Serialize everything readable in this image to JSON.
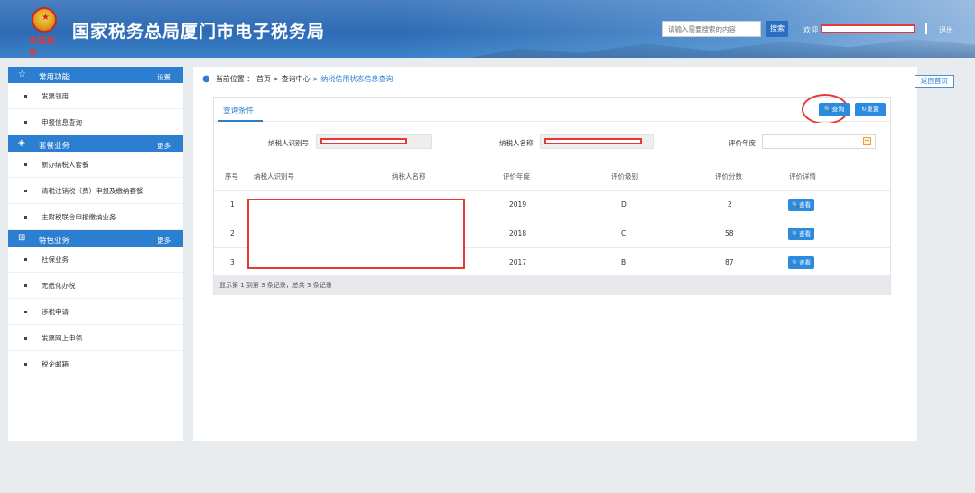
{
  "header": {
    "emblem_seal_text": "中国税务",
    "title": "国家税务总局厦门市电子税务局",
    "search_placeholder": "请输入需要搜索的内容",
    "search_button": "搜索",
    "welcome": "欢迎",
    "logout": "退出"
  },
  "sidebar": {
    "sections": [
      {
        "title": "常用功能",
        "action": "设置",
        "icon": "star-icon",
        "items": [
          "发票领用",
          "申报信息查询"
        ]
      },
      {
        "title": "套餐业务",
        "action": "更多",
        "icon": "layers-icon",
        "items": [
          "新办纳税人套餐",
          "清税注销税（费）申报及缴纳套餐",
          "主附税联合申报缴纳业务"
        ]
      },
      {
        "title": "特色业务",
        "action": "更多",
        "icon": "grid-icon",
        "items": [
          "社保业务",
          "无纸化办税",
          "涉税申请",
          "发票网上申领",
          "税企邮箱"
        ]
      }
    ]
  },
  "breadcrumb": {
    "label": "当前位置 ：",
    "home": "首页",
    "level2": " > 查询中心",
    "current": " > 纳税信用状态信息查询"
  },
  "back_home": "返回首页",
  "query_panel": {
    "tab": "查询条件",
    "query_button": "查询",
    "reset_button": "重置",
    "taxpayer_id_label": "纳税人识别号",
    "taxpayer_name_label": "纳税人名称",
    "eval_year_label": "评价年度"
  },
  "table": {
    "headers": [
      "序号",
      "纳税人识别号",
      "纳税人名称",
      "评价年度",
      "评价级别",
      "评价分数",
      "评价详情"
    ],
    "rows": [
      {
        "no": "1",
        "year": "2019",
        "level": "D",
        "score": "2",
        "detail": "查看"
      },
      {
        "no": "2",
        "year": "2018",
        "level": "C",
        "score": "58",
        "detail": "查看"
      },
      {
        "no": "3",
        "year": "2017",
        "level": "B",
        "score": "87",
        "detail": "查看"
      }
    ],
    "footer": "显示第 1 到第 3 条记录，总共 3 条记录"
  },
  "colors": {
    "primary": "#2b7ed0",
    "button": "#2b8be0",
    "annotation_red": "#e53935"
  }
}
